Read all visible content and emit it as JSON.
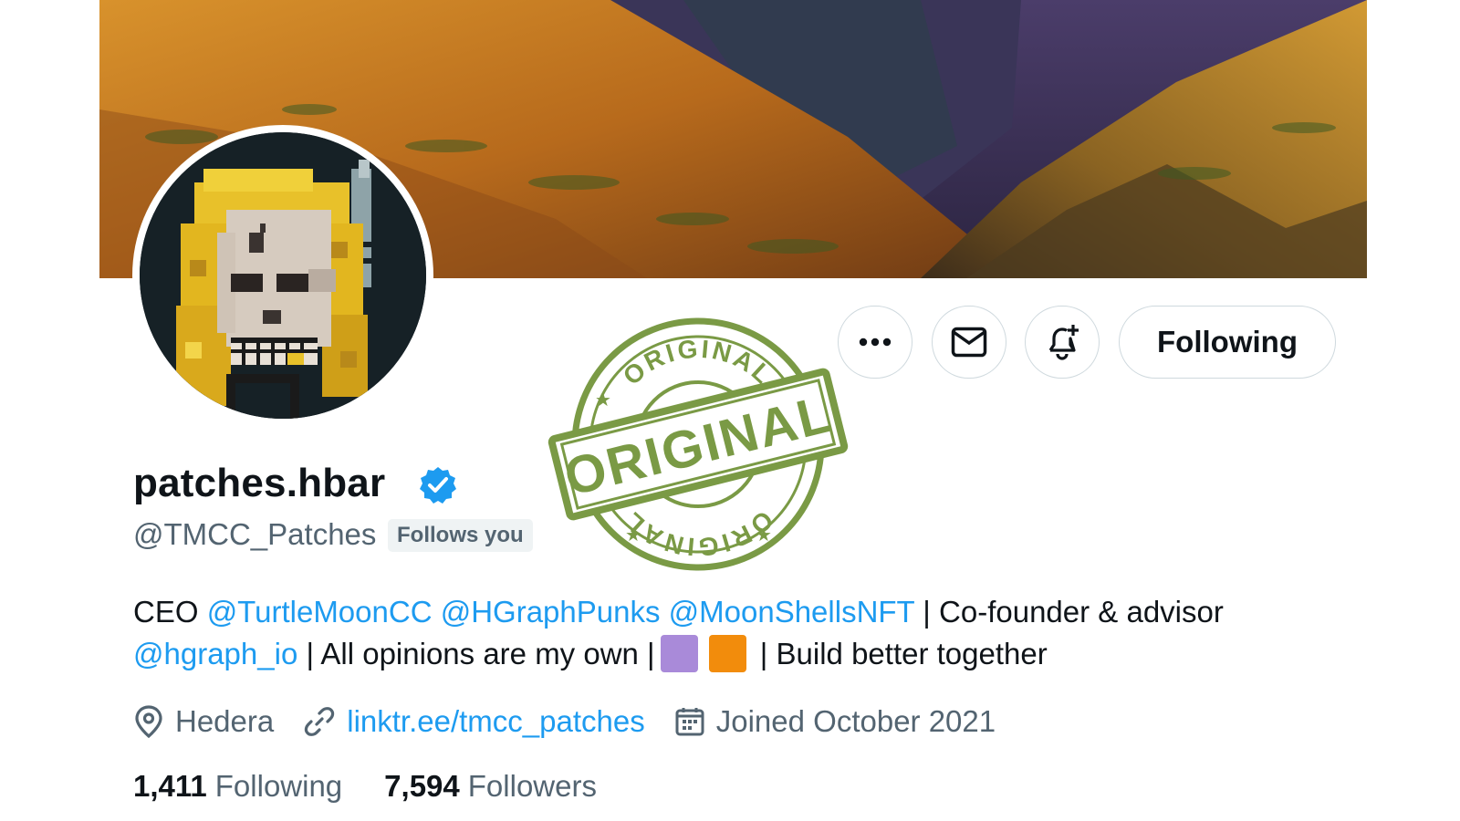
{
  "profile": {
    "display_name": "patches.hbar",
    "handle": "@TMCC_Patches",
    "follows_you_label": "Follows you",
    "verified_color": "#1d9bf0"
  },
  "actions": {
    "more_icon": "more-horizontal-icon",
    "message_icon": "mail-icon",
    "notify_icon": "bell-plus-icon",
    "following_label": "Following"
  },
  "bio": {
    "prefix": "CEO ",
    "mention_1": "@TurtleMoonCC",
    "mention_2": "@HGraphPunks",
    "mention_3": "@MoonShellsNFT",
    "text_1": " | Co-founder & advisor",
    "mention_4": "@hgraph_io",
    "text_2": " | All opinions are my own |",
    "square_colors": [
      "#a98ad9",
      "#f28c0c"
    ],
    "text_3": " | Build better together"
  },
  "meta": {
    "location": "Hedera",
    "website": "linktr.ee/tmcc_patches",
    "joined": "Joined October 2021"
  },
  "stats": {
    "following_count": "1,411",
    "following_label": "Following",
    "followers_count": "7,594",
    "followers_label": "Followers"
  },
  "stamp": {
    "top_text": "ORIGINAL",
    "center_text": "ORIGINAL",
    "bottom_text": "ORIGINAL",
    "color": "#7a9a45"
  },
  "colors": {
    "link": "#1d9bf0",
    "secondary_text": "#536471",
    "primary_text": "#0f1419"
  }
}
